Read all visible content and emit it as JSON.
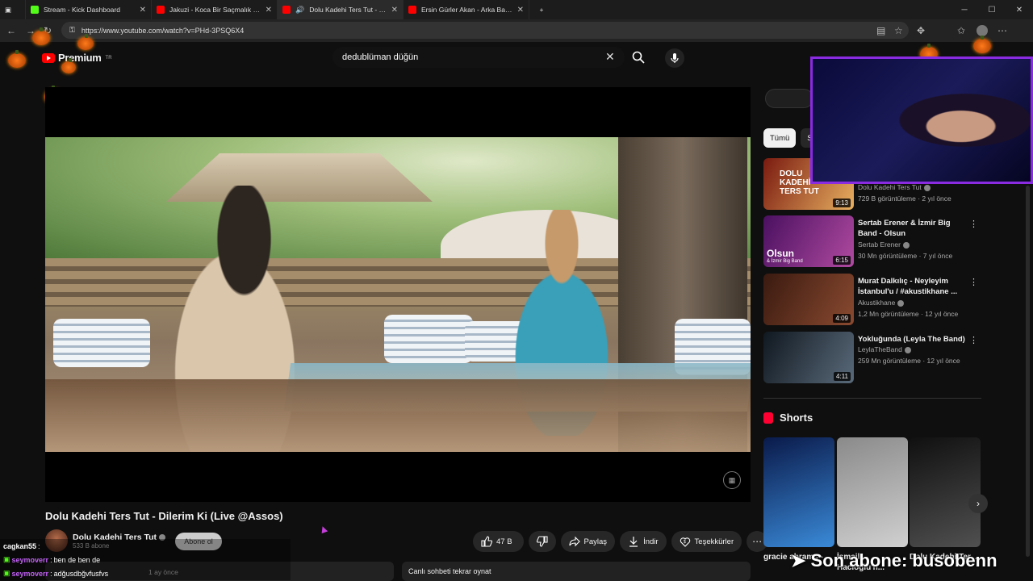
{
  "browser": {
    "tabs": [
      {
        "title": "Stream - Kick Dashboard",
        "color": "#53fc18"
      },
      {
        "title": "Jakuzi - Koca Bir Saçmalık (Officia",
        "color": "#ff0000"
      },
      {
        "title": "Dolu Kadehi Ters Tut - Dileri",
        "color": "#ff0000"
      },
      {
        "title": "Ersin Gürler Akan - Arka Bahçe - Y",
        "color": "#ff0000"
      }
    ],
    "url": "https://www.youtube.com/watch?v=PHd-3PSQ6X4"
  },
  "masthead": {
    "logo_text": "Premium",
    "logo_super": "TR",
    "search_value": "dedublüman düğün"
  },
  "video": {
    "title": "Dolu Kadehi Ters Tut - Dilerim Ki (Live @Assos)",
    "channel": "Dolu Kadehi Ters Tut",
    "subscribers": "533 B abone",
    "subscribe_label": "Abone ol",
    "likes": "47 B",
    "share_label": "Paylaş",
    "download_label": "İndir",
    "thanks_label": "Teşekkürler",
    "desc_time": "1 ay önce",
    "replay_label": "Canlı sohbeti tekrar oynat"
  },
  "chat": [
    {
      "user": "cagkan55",
      "sep": " :",
      "msg": "",
      "style": "plain"
    },
    {
      "user": "seymoverr",
      "sep": " :",
      "msg": " ben de ben de",
      "style": "badge"
    },
    {
      "user": "seymoverr",
      "sep": " :",
      "msg": " adğusdbğvfusfvs",
      "style": "badge"
    }
  ],
  "chips": [
    "Tümü",
    "S"
  ],
  "recommendations": [
    {
      "title": "",
      "channel": "Dolu Kadehi Ters Tut",
      "meta": "729 B görüntüleme · 2 yıl önce",
      "duration": "9:13",
      "thumb_colors": [
        "#7a1a10",
        "#e8b060"
      ]
    },
    {
      "title": "Sertab Erener & İzmir Big Band - Olsun",
      "channel": "Sertab Erener",
      "meta": "30 Mn görüntüleme · 7 yıl önce",
      "duration": "6:15",
      "thumb_colors": [
        "#4a1060",
        "#b04aa0"
      ]
    },
    {
      "title": "Murat Dalkılıç - Neyleyim İstanbul'u / #akustikhane ...",
      "channel": "Akustikhane",
      "meta": "1,2 Mn görüntüleme · 12 yıl önce",
      "duration": "4:09",
      "thumb_colors": [
        "#3a1a10",
        "#8a4a30"
      ]
    },
    {
      "title": "Yokluğunda (Leyla The Band)",
      "channel": "LeylaTheBand",
      "meta": "259 Mn görüntüleme · 12 yıl önce",
      "duration": "4:11",
      "thumb_colors": [
        "#101820",
        "#5a6a7a"
      ]
    }
  ],
  "shorts": {
    "heading": "Shorts",
    "items": [
      {
        "title": "gracie abrams -",
        "colors": [
          "#0a1a4a",
          "#3a8ad8"
        ]
      },
      {
        "title": "İsmail Hacıoğlu'n...",
        "colors": [
          "#8a8a8a",
          "#d0d0d0"
        ]
      },
      {
        "title": "Dolu Kadehi Ter...",
        "colors": [
          "#101010",
          "#505050"
        ]
      }
    ]
  },
  "thumb_texts": {
    "olsun": "Olsun",
    "olsun_sub": "& İzmir Big Band",
    "first": "DOLU KADEHİ TERS TUT"
  },
  "overlay": {
    "text": "➤ Son abone: busobenn"
  }
}
